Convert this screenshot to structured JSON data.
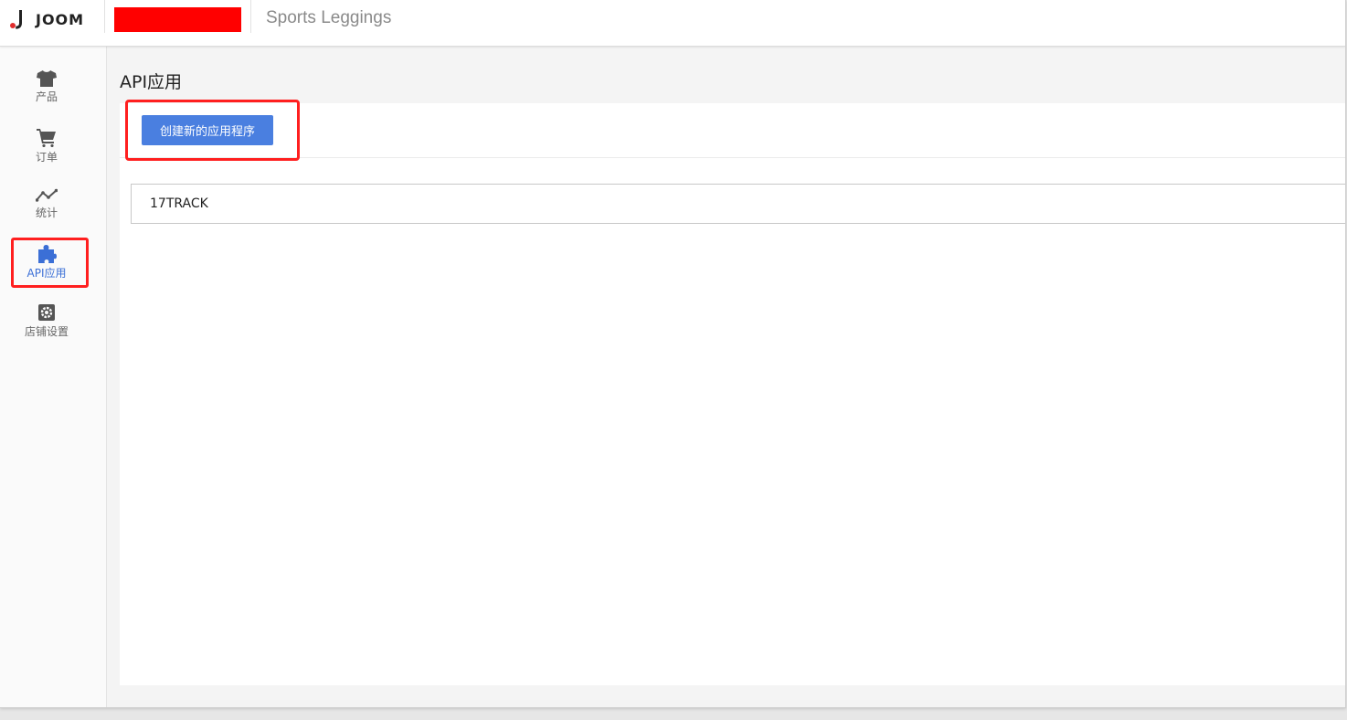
{
  "header": {
    "logo_text": "JOOM",
    "store_name": "Sports Leggings",
    "redaction_color": "#ff0000"
  },
  "sidebar": {
    "items": [
      {
        "label": "产品",
        "icon": "tshirt-icon",
        "active": false
      },
      {
        "label": "订单",
        "icon": "cart-icon",
        "active": false
      },
      {
        "label": "统计",
        "icon": "chart-line-icon",
        "active": false
      },
      {
        "label": "API应用",
        "icon": "puzzle-icon",
        "active": true
      },
      {
        "label": "店铺设置",
        "icon": "gear-icon",
        "active": false
      }
    ]
  },
  "main": {
    "title": "API应用",
    "create_button_label": "创建新的应用程序",
    "apps": [
      {
        "name": "17TRACK"
      }
    ]
  },
  "colors": {
    "accent": "#4a7fe0",
    "active_nav": "#3b6fd6",
    "highlight": "#ff1f1f",
    "logo_dot": "#e02d2d"
  }
}
